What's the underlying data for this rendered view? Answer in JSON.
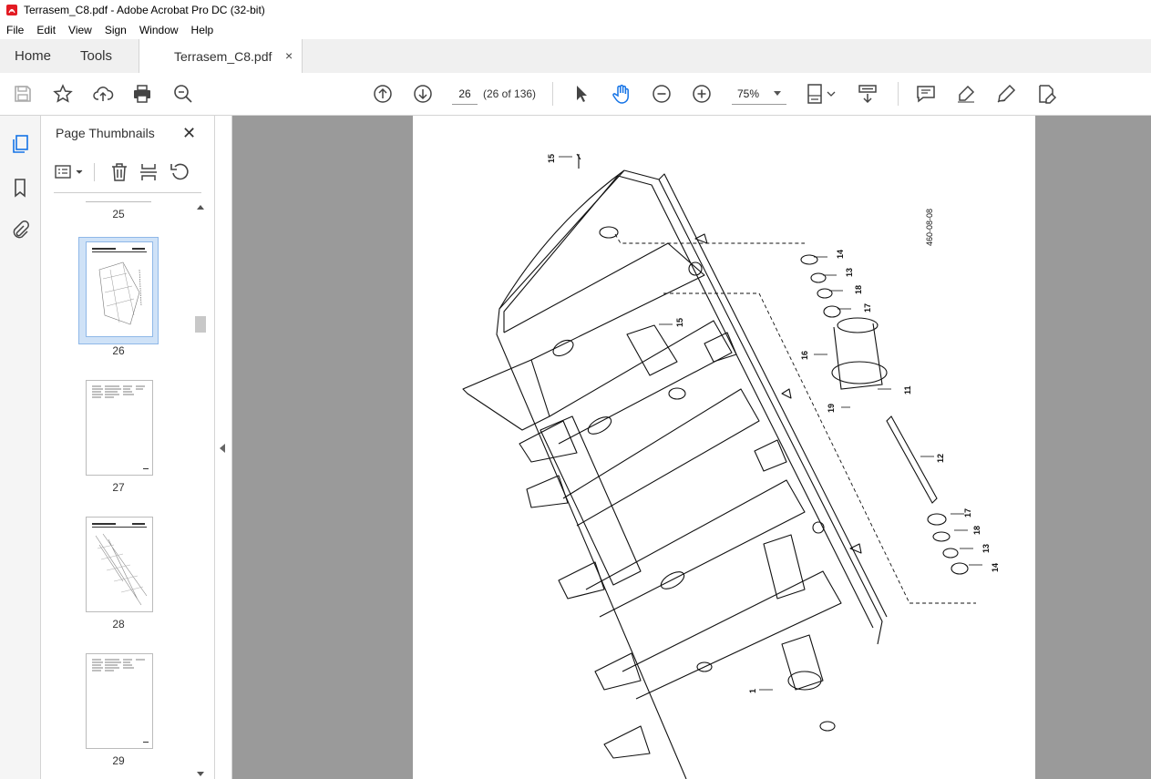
{
  "window": {
    "title": "Terrasem_C8.pdf - Adobe Acrobat Pro DC (32-bit)"
  },
  "menu": [
    "File",
    "Edit",
    "View",
    "Sign",
    "Window",
    "Help"
  ],
  "tabs": {
    "home": "Home",
    "tools": "Tools",
    "document": "Terrasem_C8.pdf",
    "close": "×"
  },
  "toolbar": {
    "page_current": "26",
    "page_count": "(26 of 136)",
    "zoom": "75%"
  },
  "sidebar": {
    "panel_title": "Page Thumbnails",
    "close": "✕",
    "thumbnails": [
      {
        "label": "25"
      },
      {
        "label": "26"
      },
      {
        "label": "27"
      },
      {
        "label": "28"
      },
      {
        "label": "29"
      }
    ]
  },
  "drawing": {
    "doc_code": "460-08-08",
    "callouts": [
      "15",
      "14",
      "13",
      "18",
      "17",
      "15",
      "16",
      "11",
      "19",
      "12",
      "17",
      "18",
      "13",
      "14",
      "1"
    ]
  },
  "colors": {
    "accent": "#1473e6",
    "chrome": "#f0f0f0",
    "canvas": "#9a9a9a",
    "pdf_red": "#e31b23"
  }
}
